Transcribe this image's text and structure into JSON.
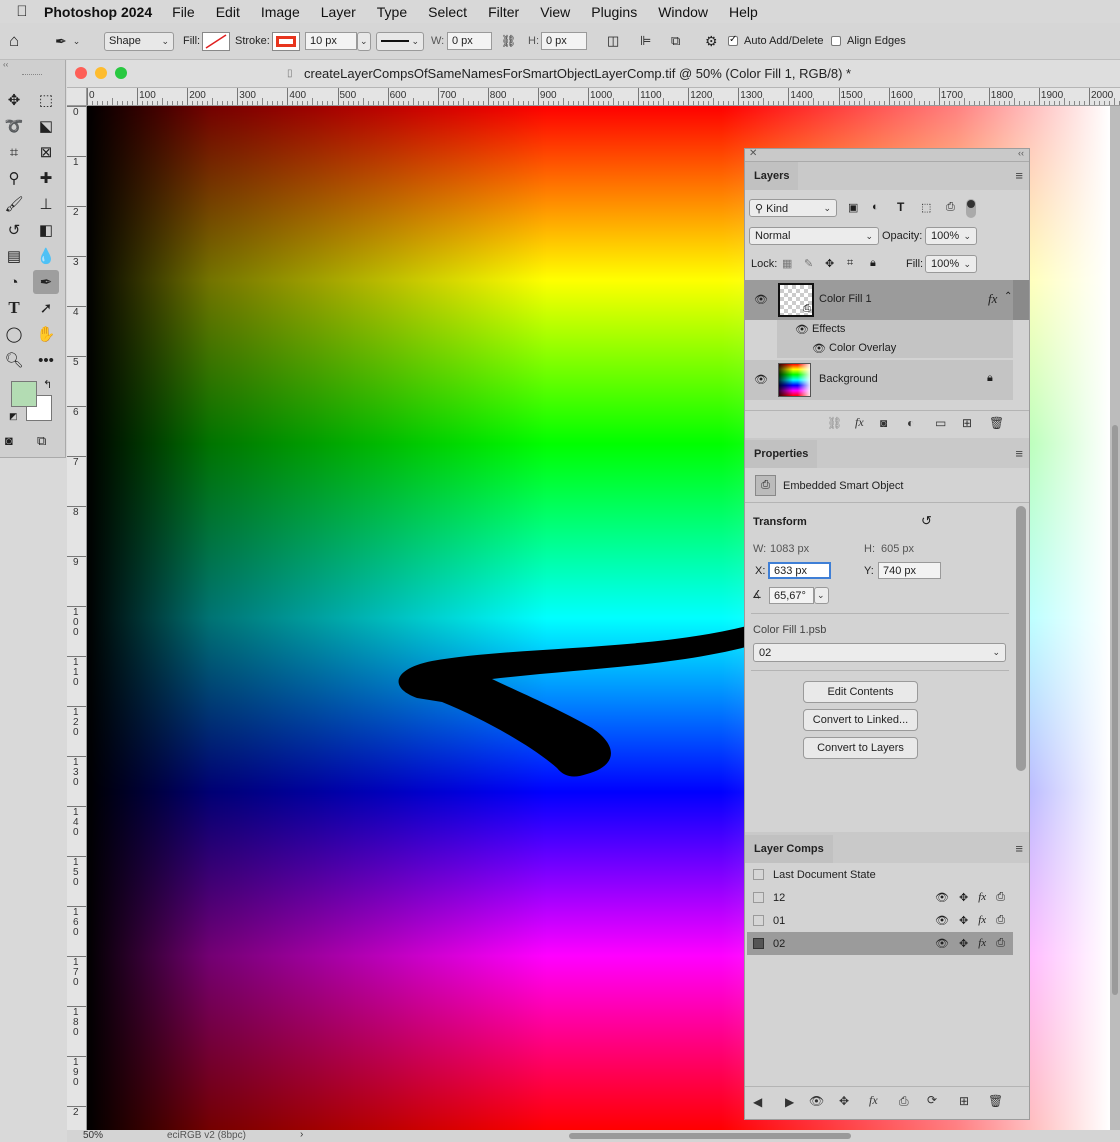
{
  "menubar": {
    "app": "Photoshop 2024",
    "items": [
      "File",
      "Edit",
      "Image",
      "Layer",
      "Type",
      "Select",
      "Filter",
      "View",
      "Plugins",
      "Window",
      "Help"
    ]
  },
  "options": {
    "mode": "Shape",
    "fill_label": "Fill:",
    "stroke_label": "Stroke:",
    "stroke_width": "10 px",
    "w_label": "W:",
    "w_value": "0 px",
    "h_label": "H:",
    "h_value": "0 px",
    "auto_add_delete": "Auto Add/Delete",
    "auto_add_delete_checked": true,
    "align_edges": "Align Edges",
    "align_edges_checked": false
  },
  "colors": {
    "foreground": "#b3dcb3",
    "background": "#ffffff",
    "stroke_swatch": "#e8351e"
  },
  "document": {
    "title": "createLayerCompsOfSameNamesForSmartObjectLayerComp.tif @ 50% (Color Fill 1, RGB/8) *",
    "zoom": "50%",
    "color_profile": "eciRGB v2 (8bpc)",
    "ruler_h": [
      "0",
      "100",
      "200",
      "300",
      "400",
      "500",
      "600",
      "700",
      "800",
      "900",
      "1000",
      "1100",
      "1200",
      "1300",
      "1400",
      "1500",
      "1600",
      "1700",
      "1800",
      "1900",
      "2000"
    ],
    "ruler_v": [
      "0",
      "1",
      "2",
      "3",
      "4",
      "5",
      "6",
      "7",
      "8",
      "9",
      "1 0 0",
      "1 1 0",
      "1 2 0",
      "1 3 0",
      "1 4 0",
      "1 5 0",
      "1 6 0",
      "1 7 0",
      "1 8 0",
      "1 9 0",
      "2"
    ]
  },
  "layers": {
    "tab": "Layers",
    "filter": "Kind",
    "blend_mode": "Normal",
    "opacity_label": "Opacity:",
    "opacity": "100%",
    "lock_label": "Lock:",
    "fill_label": "Fill:",
    "fill": "100%",
    "items": [
      {
        "name": "Color Fill 1",
        "effects_label": "Effects",
        "effect": "Color Overlay"
      },
      {
        "name": "Background"
      }
    ]
  },
  "properties": {
    "tab": "Properties",
    "type": "Embedded Smart Object",
    "transform": "Transform",
    "w_label": "W:",
    "w_value": "1083 px",
    "h_label": "H:",
    "h_value": "605 px",
    "x_label": "X:",
    "x_value": "633 px",
    "y_label": "Y:",
    "y_value": "740 px",
    "angle": "65,67°",
    "file_name": "Color Fill 1.psb",
    "comp_select": "02",
    "buttons": [
      "Edit Contents",
      "Convert to Linked...",
      "Convert to Layers"
    ]
  },
  "layer_comps": {
    "tab": "Layer Comps",
    "last_state": "Last Document State",
    "items": [
      "12",
      "01",
      "02"
    ],
    "selected": "02"
  }
}
